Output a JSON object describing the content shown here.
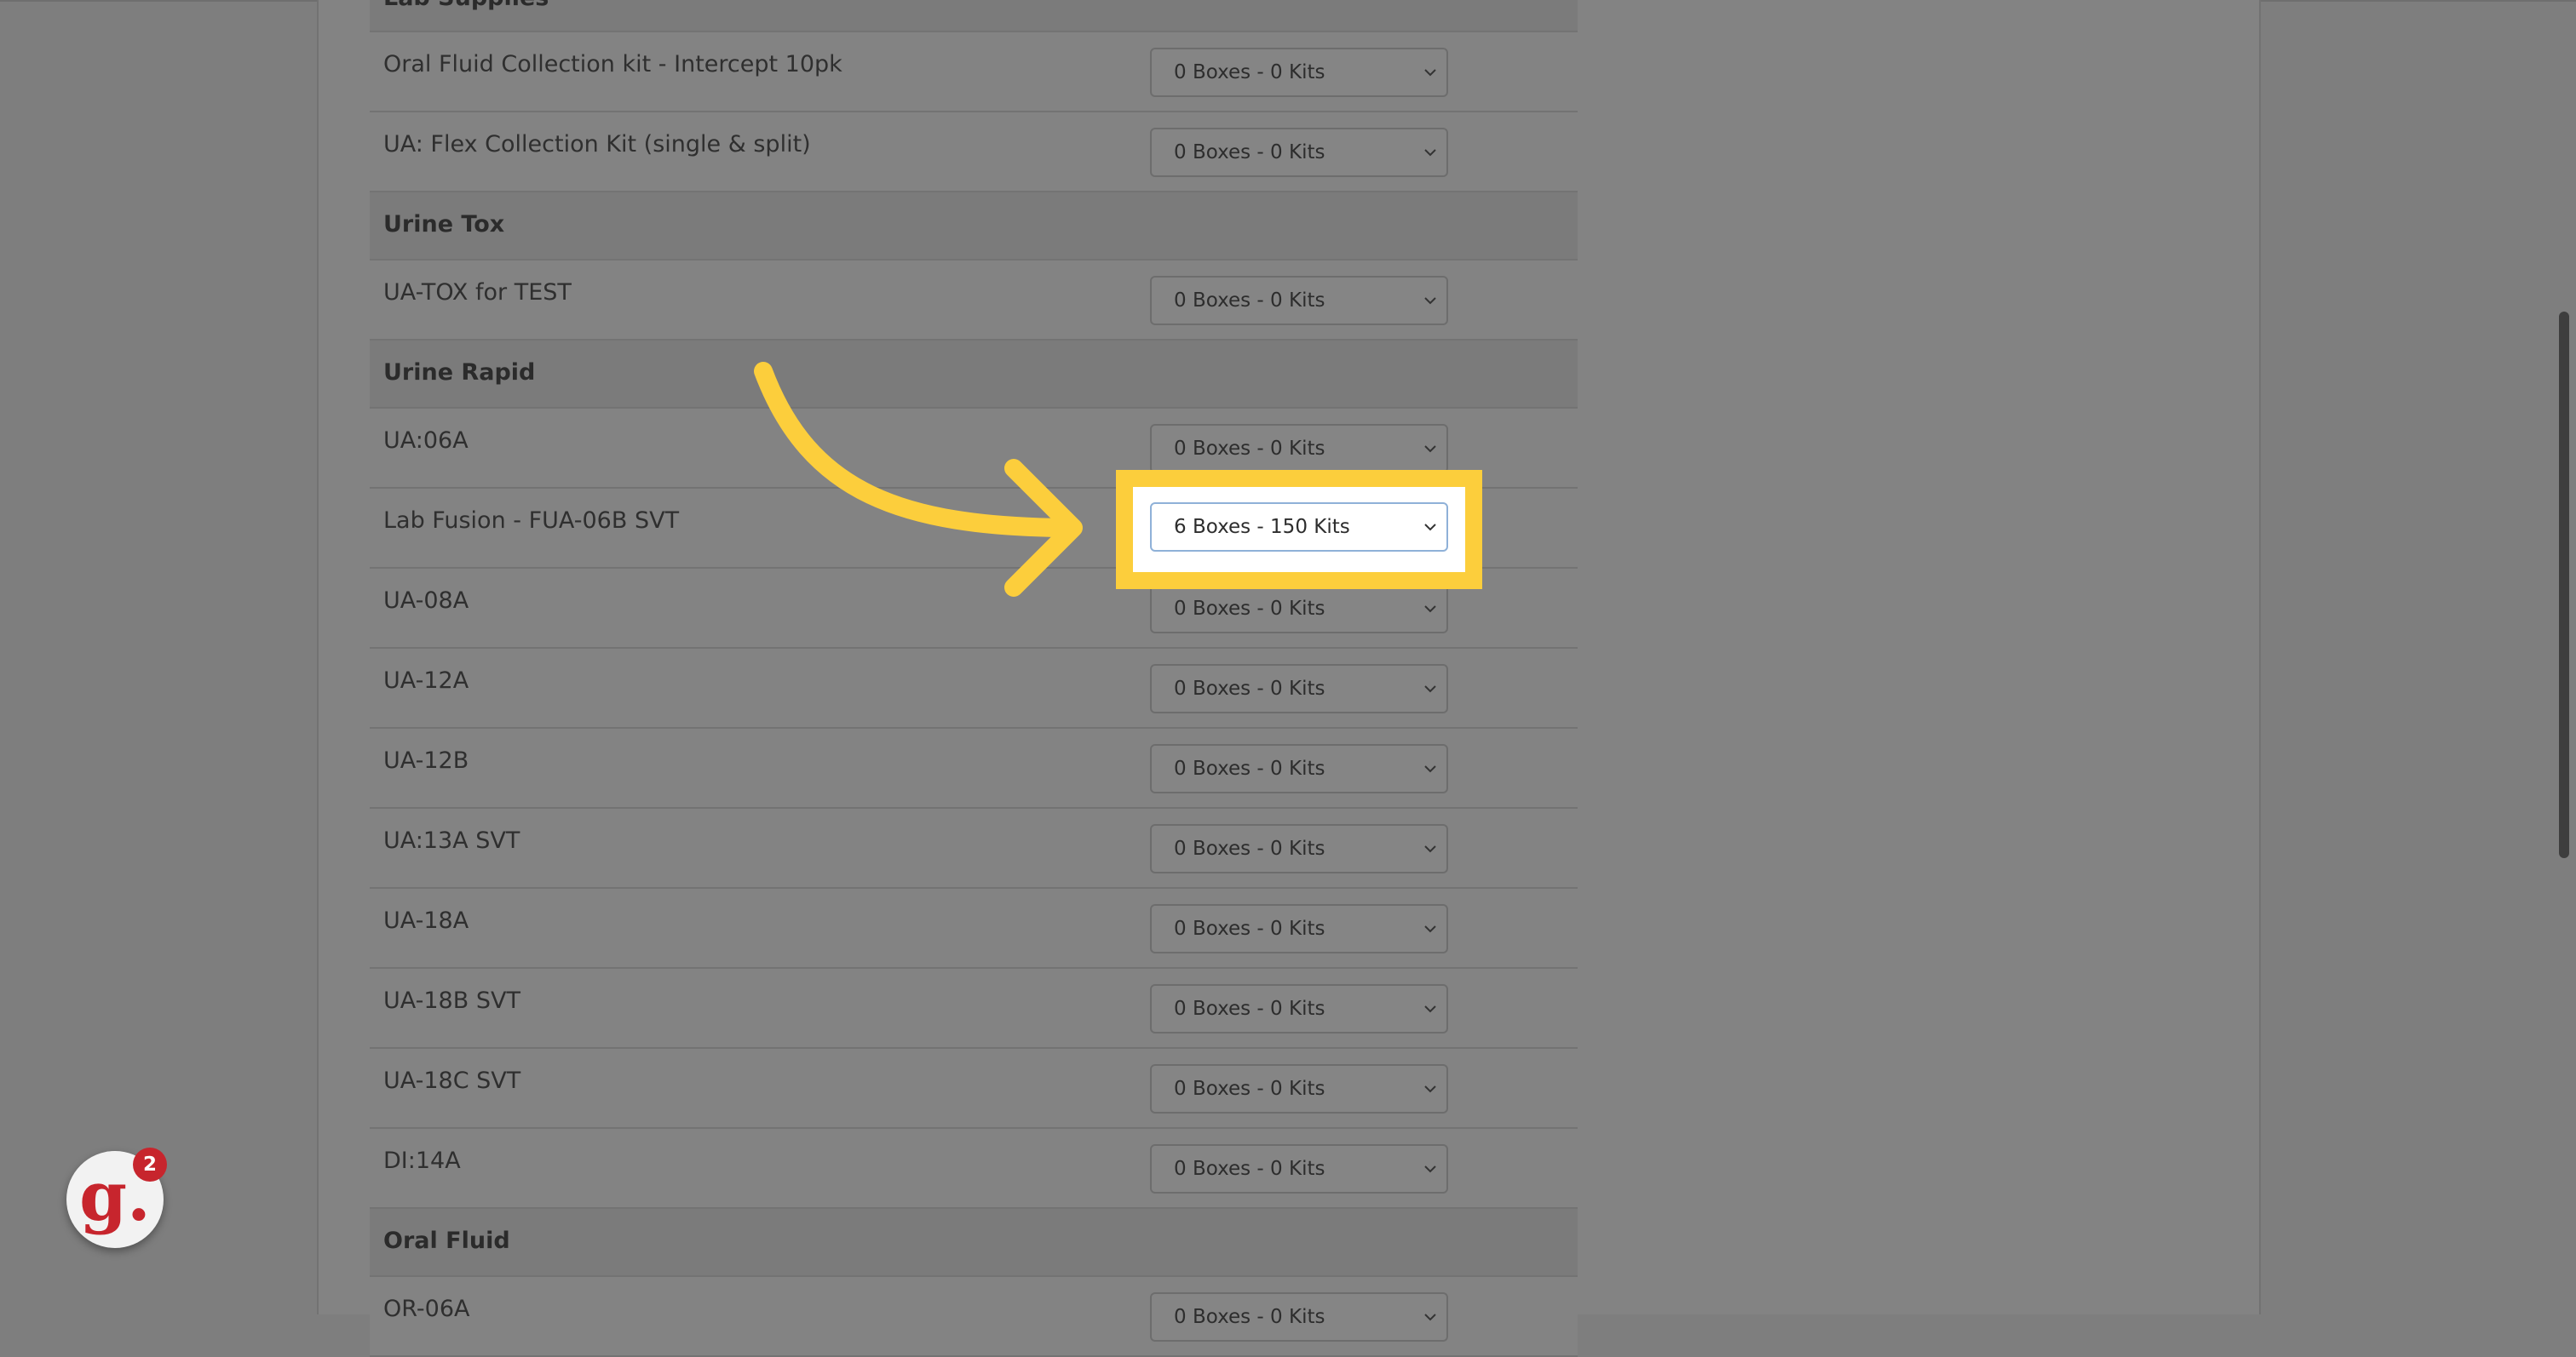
{
  "sections": [
    {
      "type": "cat",
      "label": "Lab Supplies"
    },
    {
      "type": "item",
      "label": "Oral Fluid Collection kit - Intercept 10pk",
      "value": "0 Boxes - 0 Kits"
    },
    {
      "type": "item",
      "label": "UA: Flex Collection Kit (single & split)",
      "value": "0 Boxes - 0 Kits"
    },
    {
      "type": "cat",
      "label": "Urine Tox"
    },
    {
      "type": "item",
      "label": "UA-TOX for TEST",
      "value": "0 Boxes - 0 Kits"
    },
    {
      "type": "cat",
      "label": "Urine Rapid"
    },
    {
      "type": "item",
      "label": "UA:06A",
      "value": "0 Boxes - 0 Kits"
    },
    {
      "type": "item",
      "label": "Lab Fusion - FUA-06B SVT",
      "value": "6 Boxes - 150 Kits"
    },
    {
      "type": "item",
      "label": "UA-08A",
      "value": "0 Boxes - 0 Kits"
    },
    {
      "type": "item",
      "label": "UA-12A",
      "value": "0 Boxes - 0 Kits"
    },
    {
      "type": "item",
      "label": "UA-12B",
      "value": "0 Boxes - 0 Kits"
    },
    {
      "type": "item",
      "label": "UA:13A SVT",
      "value": "0 Boxes - 0 Kits"
    },
    {
      "type": "item",
      "label": "UA-18A",
      "value": "0 Boxes - 0 Kits"
    },
    {
      "type": "item",
      "label": "UA-18B SVT",
      "value": "0 Boxes - 0 Kits"
    },
    {
      "type": "item",
      "label": "UA-18C SVT",
      "value": "0 Boxes - 0 Kits"
    },
    {
      "type": "item",
      "label": "DI:14A",
      "value": "0 Boxes - 0 Kits"
    },
    {
      "type": "cat",
      "label": "Oral Fluid"
    },
    {
      "type": "item",
      "label": "OR-06A",
      "value": "0 Boxes - 0 Kits"
    }
  ],
  "highlighted_select": {
    "value": "6 Boxes - 150 Kits"
  },
  "badge": {
    "letter": "g.",
    "count": "2"
  },
  "colors": {
    "highlight": "#fcce3c",
    "brand_red": "#c7252d"
  }
}
